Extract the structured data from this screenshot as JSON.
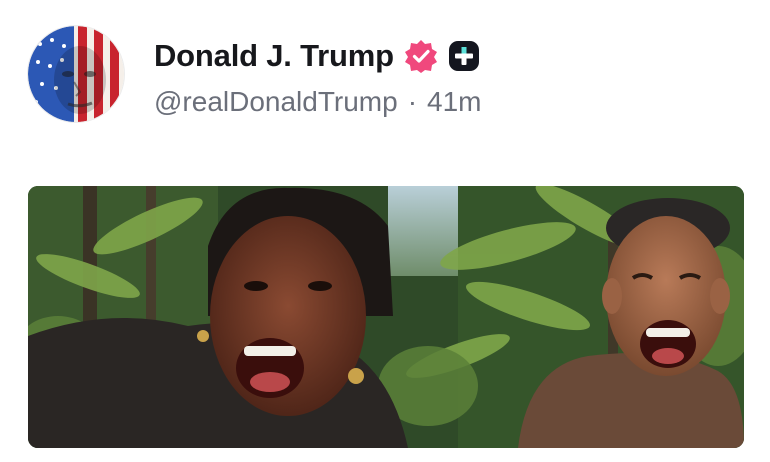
{
  "post": {
    "display_name": "Donald J. Trump",
    "handle": "@realDonaldTrump",
    "separator": "·",
    "time_ago": "41m",
    "verified_badge_color": "#f0487d",
    "plus_badge_color": "#14161f",
    "icons": {
      "verified": "verified-check-icon",
      "plus": "truth-plus-icon"
    },
    "avatar_description": "avatar-flag-face",
    "media_description": "post-image"
  }
}
